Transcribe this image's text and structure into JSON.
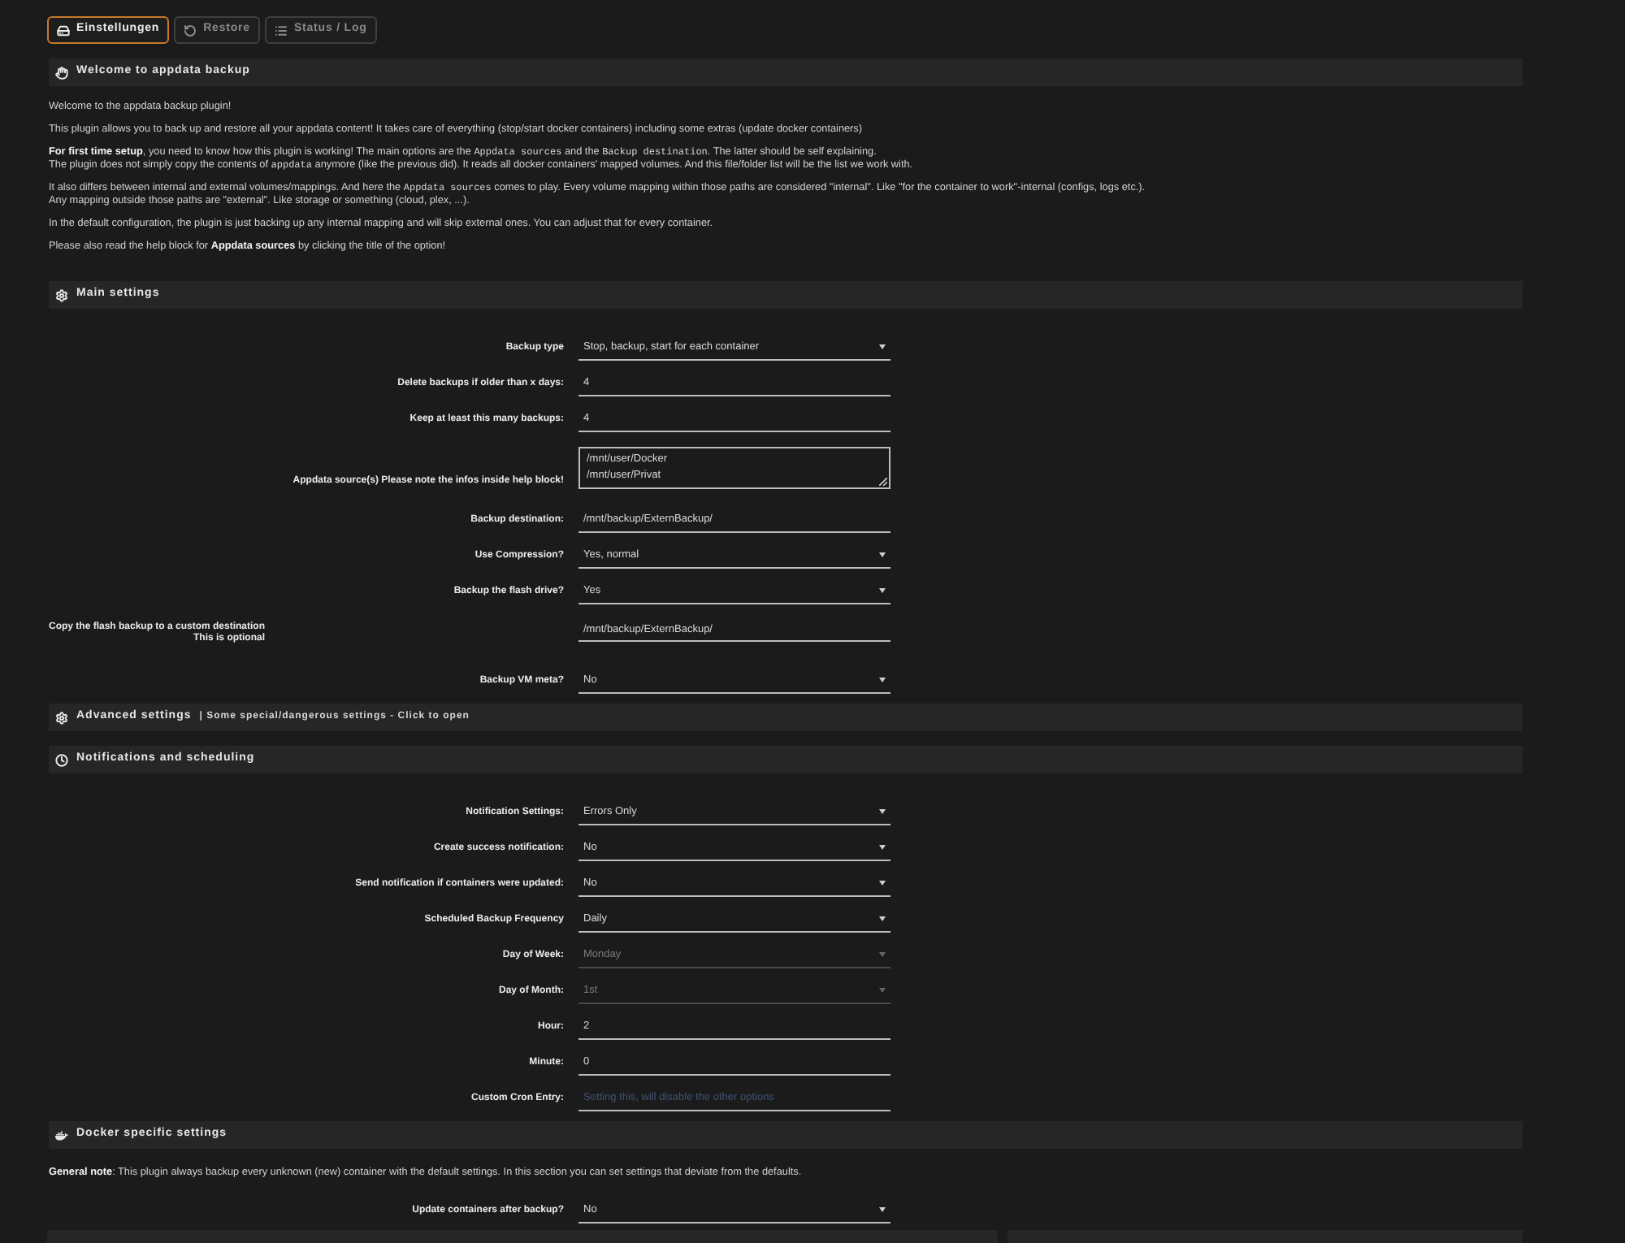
{
  "tabs": [
    {
      "label": "Einstellungen",
      "selected": true
    },
    {
      "label": "Restore",
      "selected": false
    },
    {
      "label": "Status / Log",
      "selected": false
    }
  ],
  "sections": [
    {
      "kind": "text",
      "title": "Welcome to appdata backup",
      "paragraphs": [
        {
          "lines": [
            [
              {
                "kind": "text",
                "text": "Welcome to the appdata backup plugin!"
              }
            ]
          ]
        },
        {
          "lines": [
            [
              {
                "kind": "text",
                "text": "This plugin allows you to back up and restore all your appdata content! It takes care of everything (stop/start docker containers) including some extras (update docker containers)"
              }
            ]
          ]
        },
        {
          "lines": [
            [
              {
                "kind": "bold",
                "text": "For first time setup"
              },
              {
                "kind": "text",
                "text": ", you need to know how this plugin is working! The main options are the "
              },
              {
                "kind": "code",
                "text": "Appdata sources"
              },
              {
                "kind": "text",
                "text": " and the "
              },
              {
                "kind": "code",
                "text": "Backup destination"
              },
              {
                "kind": "text",
                "text": ". The latter should be self explaining."
              }
            ],
            [
              {
                "kind": "text",
                "text": "The plugin does not simply copy the contents of "
              },
              {
                "kind": "code",
                "text": "appdata"
              },
              {
                "kind": "text",
                "text": " anymore (like the previous did). It reads all docker containers' mapped volumes. And this file/folder list will be the list we work with."
              }
            ]
          ]
        },
        {
          "lines": [
            [
              {
                "kind": "text",
                "text": "It also differs between internal and external volumes/mappings. And here the "
              },
              {
                "kind": "code",
                "text": "Appdata sources"
              },
              {
                "kind": "text",
                "text": " comes to play. Every volume mapping within those paths are considered \"internal\". Like \"for the container to work\"-internal (configs, logs etc.)."
              }
            ],
            [
              {
                "kind": "text",
                "text": "Any mapping outside those paths are \"external\". Like storage or something (cloud, plex, ...)."
              }
            ]
          ]
        },
        {
          "lines": [
            [
              {
                "kind": "text",
                "text": "In the default configuration, the plugin is just backing up any internal mapping and will skip external ones. You can adjust that for every container."
              }
            ]
          ]
        },
        {
          "lines": [
            [
              {
                "kind": "text",
                "text": "Please also read the help block for "
              },
              {
                "kind": "bold",
                "text": "Appdata sources"
              },
              {
                "kind": "text",
                "text": " by clicking the title of the option!"
              }
            ]
          ]
        }
      ]
    },
    {
      "kind": "form",
      "title": "Main settings",
      "rows": [
        {
          "kind": "select",
          "label": "Backup type",
          "value": "Stop, backup, start for each container",
          "disabled": false
        },
        {
          "kind": "input",
          "label": "Delete backups if older than x days:",
          "value": "4",
          "disabled": false
        },
        {
          "kind": "input",
          "label": "Keep at least this many backups:",
          "value": "4",
          "disabled": false
        },
        {
          "kind": "textarea",
          "label": "Appdata source(s) Please note the infos inside help block!",
          "value": "/mnt/user/Docker\n/mnt/user/Privat",
          "disabled": false
        },
        {
          "kind": "input",
          "label": "Backup destination:",
          "value": "/mnt/backup/ExternBackup/",
          "disabled": false
        },
        {
          "kind": "select",
          "label": "Use Compression?",
          "value": "Yes, normal",
          "disabled": false
        },
        {
          "kind": "select",
          "label": "Backup the flash drive?",
          "value": "Yes",
          "disabled": false
        },
        {
          "kind": "input",
          "label": "Copy the flash backup to a custom destination",
          "hint": "This is optional",
          "value": "/mnt/backup/ExternBackup/",
          "disabled": false
        },
        {
          "kind": "select",
          "label": "Backup VM meta?",
          "value": "No",
          "disabled": false
        }
      ]
    },
    {
      "kind": "collapsed",
      "title": "Advanced settings",
      "subtitle": "| Some special/dangerous settings - Click to open"
    },
    {
      "kind": "form",
      "title": "Notifications and scheduling",
      "rows": [
        {
          "kind": "select",
          "label": "Notification Settings:",
          "value": "Errors Only",
          "disabled": false
        },
        {
          "kind": "select",
          "label": "Create success notification:",
          "value": "No",
          "disabled": false
        },
        {
          "kind": "select",
          "label": "Send notification if containers were updated:",
          "value": "No",
          "disabled": false
        },
        {
          "kind": "select",
          "label": "Scheduled Backup Frequency",
          "value": "Daily",
          "disabled": false
        },
        {
          "kind": "select",
          "label": "Day of Week:",
          "value": "Monday",
          "disabled": true
        },
        {
          "kind": "select",
          "label": "Day of Month:",
          "value": "1st",
          "disabled": true
        },
        {
          "kind": "input",
          "label": "Hour:",
          "value": "2",
          "disabled": false
        },
        {
          "kind": "input",
          "label": "Minute:",
          "value": "0",
          "disabled": false
        },
        {
          "kind": "input",
          "label": "Custom Cron Entry:",
          "placeholder": "Setting this, will disable the other options",
          "disabled": false
        }
      ]
    },
    {
      "kind": "form",
      "title": "Docker specific settings",
      "note": "**General note**: This plugin always backup every unknown (new) container with the default settings. In this section you can set settings that deviate from the defaults.",
      "rows": [
        {
          "kind": "select",
          "label": "Update containers after backup?",
          "value": "No",
          "disabled": false
        }
      ]
    }
  ]
}
